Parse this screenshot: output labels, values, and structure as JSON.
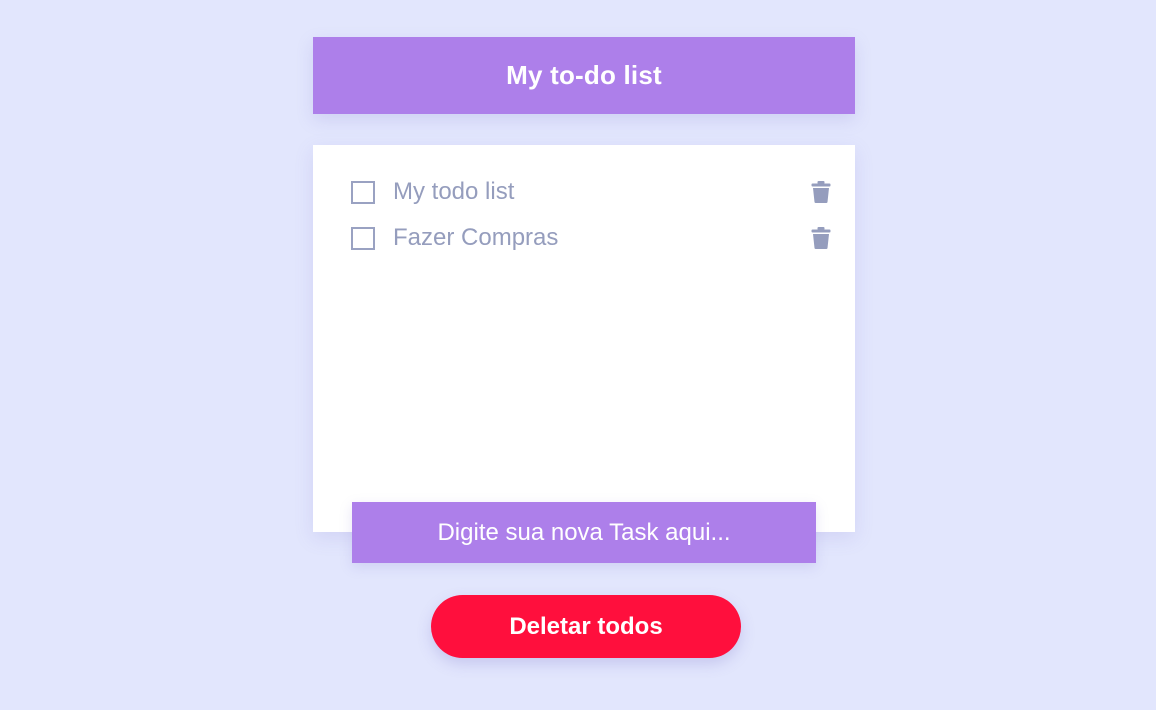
{
  "header": {
    "title": "My to-do list"
  },
  "todos": [
    {
      "text": "My todo list",
      "checked": false,
      "delete_icon": "trash-icon"
    },
    {
      "text": "Fazer Compras",
      "checked": false,
      "delete_icon": "trash-icon"
    }
  ],
  "new_task": {
    "placeholder": "Digite sua nova Task aqui...",
    "value": ""
  },
  "actions": {
    "delete_all_label": "Deletar todos"
  },
  "colors": {
    "background": "#e2e6fd",
    "accent": "#ad7fea",
    "danger": "#ff0f3d",
    "item_text": "#959dbd"
  }
}
